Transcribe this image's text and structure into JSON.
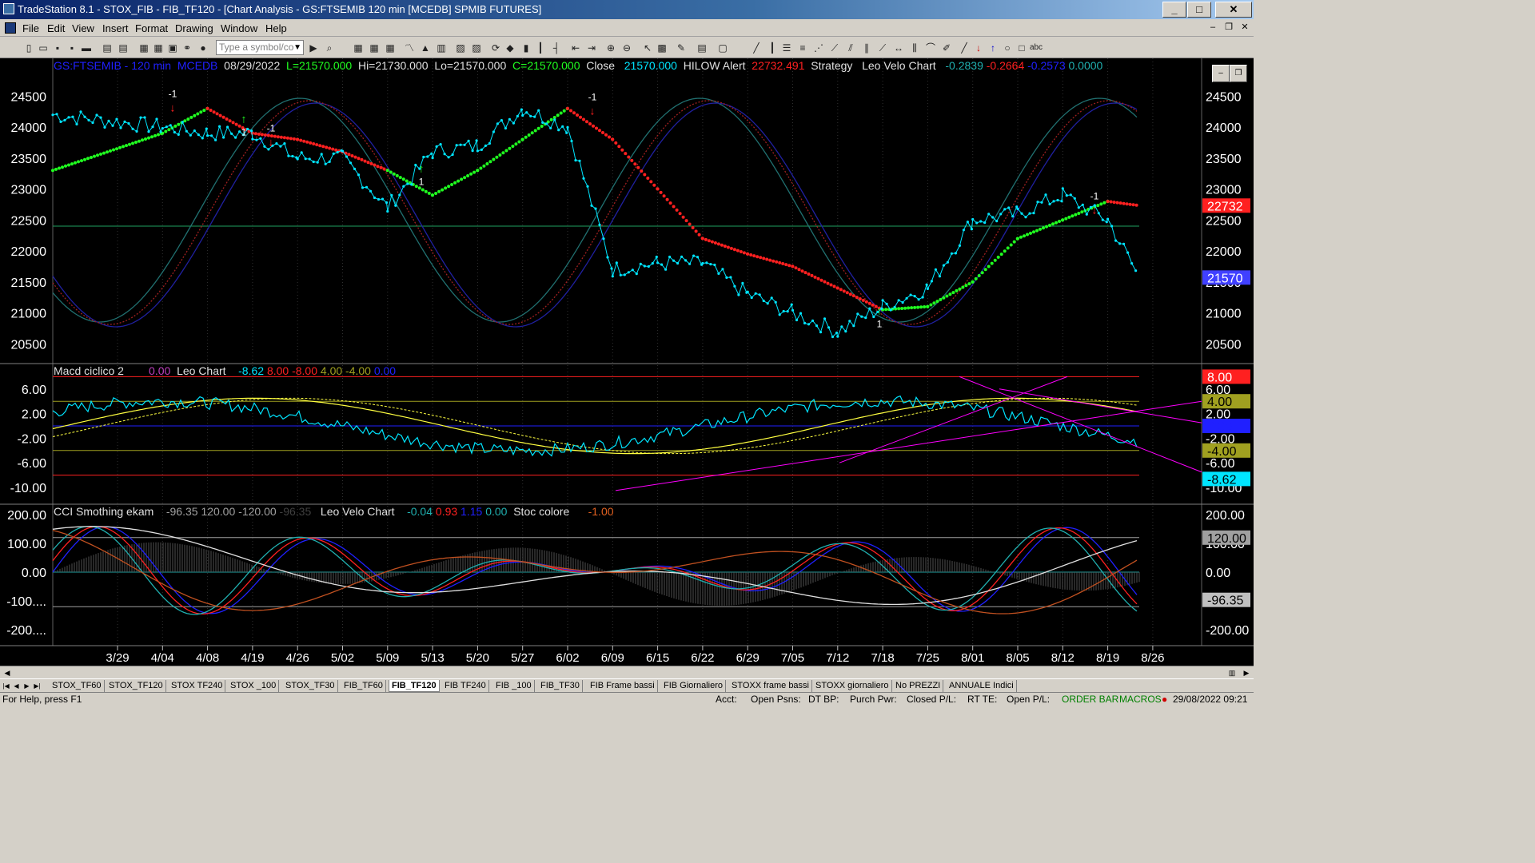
{
  "window": {
    "title": "TradeStation 8.1 - STOX_FIB - FIB_TF120 - [Chart Analysis - GS:FTSEMIB  120 min  [MCEDB] SPMIB FUTURES]",
    "minimize": "_",
    "maximize": "□",
    "close": "✕"
  },
  "menu": {
    "items": [
      "File",
      "Edit",
      "View",
      "Insert",
      "Format",
      "Drawing",
      "Window",
      "Help"
    ],
    "mdi_min": "–",
    "mdi_restore": "❐",
    "mdi_close": "✕"
  },
  "toolbar": {
    "symbol_placeholder": "Type a symbol/co",
    "text_tool": "abc"
  },
  "header": {
    "symbol": "GS:FTSEMIB - 120 min",
    "source": "MCEDB",
    "date": "08/29/2022",
    "low_label": "L=21570.000",
    "high_label": "Hi=21730.000",
    "lo_label": "Lo=21570.000",
    "close_c": "C=21570.000",
    "close_word": "Close",
    "close_val": "21570.000",
    "ind1": "HILOW Alert",
    "ind1_val": "22732.491",
    "ind2": "Strategy",
    "ind3": "Leo Velo Chart",
    "v1": "-0.2839",
    "v2": "-0.2664",
    "v3": "-0.2573",
    "v4": "0.0000"
  },
  "macd_header": {
    "name": "Macd ciclico 2",
    "v0": "0.00",
    "leo": "Leo Chart",
    "a": "-8.62",
    "b": "8.00",
    "c": "-8.00",
    "d": "4.00",
    "e": "-4.00",
    "f": "0.00"
  },
  "cci_header": {
    "name": "CCI Smothing ekam",
    "a": "-96.35",
    "b": "120.00",
    "c": "-120.00",
    "d": "-96.35",
    "leo": "Leo Velo Chart",
    "e": "-0.04",
    "f": "0.93",
    "g": "1.15",
    "h": "0.00",
    "stoc": "Stoc colore",
    "i": "-1.00"
  },
  "axes": {
    "price_ticks": [
      "24500",
      "24000",
      "23500",
      "23000",
      "22500",
      "22000",
      "21500",
      "21000",
      "20500"
    ],
    "macd_ticks": [
      "6.00",
      "2.00",
      "-2.00",
      "-6.00",
      "-10.00"
    ],
    "cci_ticks": [
      "200.00",
      "100.00",
      "0.00",
      "-100....",
      "-200...."
    ],
    "cci_ticks_right": [
      "200.00",
      "100.00",
      "0.00",
      "-100.00",
      "-200.00"
    ],
    "dates": [
      "3/29",
      "4/04",
      "4/08",
      "4/19",
      "4/26",
      "5/02",
      "5/09",
      "5/13",
      "5/20",
      "5/27",
      "6/02",
      "6/09",
      "6/15",
      "6/22",
      "6/29",
      "7/05",
      "7/12",
      "7/18",
      "7/25",
      "8/01",
      "8/05",
      "8/12",
      "8/19",
      "8/26"
    ]
  },
  "price_tags": {
    "hilow": "22732",
    "last": "21570"
  },
  "macd_tags": {
    "p8": "8.00",
    "p4": "4.00",
    "z": "0.00",
    "m4": "-4.00",
    "last": "-8.62"
  },
  "cci_tags": {
    "p120": "120.00",
    "last": "-96.35"
  },
  "signals": {
    "sell": "-1",
    "buy": "1"
  },
  "tabs": [
    "STOX_TF60",
    "STOX_TF120",
    "STOX TF240",
    "STOX _100",
    "STOX_TF30",
    "FIB_TF60",
    "FIB_TF120",
    "FIB TF240",
    "FIB _100",
    "FIB_TF30",
    "FIB Frame bassi",
    "FIB Giornaliero",
    "STOXX frame bassi",
    "STOXX giornaliero",
    "No PREZZI",
    "ANNUALE Indici"
  ],
  "active_tab": "FIB_TF120",
  "status": {
    "help": "For Help, press F1",
    "acct": "Acct:",
    "open_psns": "Open Psns:",
    "dt_bp": "DT BP:",
    "purch_pwr": "Purch Pwr:",
    "closed_pl": "Closed P/L:",
    "rt_te": "RT TE:",
    "open_pl": "Open P/L:",
    "order_bar": "ORDER BAR",
    "macros": "MACROS",
    "datetime": "29/08/2022 09:21"
  },
  "colors": {
    "bg": "#000000",
    "price": "#00e5ff",
    "hilow_red": "#ff2020",
    "hilow_green": "#20ff20",
    "navy": "#2020ff",
    "magenta": "#ff00ff",
    "yellow": "#ffff40"
  },
  "chart_data": {
    "type": "line",
    "x": [
      "3/29",
      "4/04",
      "4/08",
      "4/19",
      "4/26",
      "5/02",
      "5/09",
      "5/13",
      "5/20",
      "5/27",
      "6/02",
      "6/09",
      "6/15",
      "6/22",
      "6/29",
      "7/05",
      "7/12",
      "7/18",
      "7/25",
      "8/01",
      "8/05",
      "8/12",
      "8/19",
      "8/26"
    ],
    "series": [
      {
        "name": "GS:FTSEMIB - 120 min",
        "values": [
          24200,
          24000,
          23900,
          23900,
          23500,
          23500,
          22700,
          23600,
          23700,
          24300,
          24000,
          21700,
          21800,
          21800,
          21300,
          21000,
          20700,
          21100,
          21400,
          22500,
          22600,
          22900,
          22500,
          21570
        ]
      },
      {
        "name": "HILOW Alert",
        "values": [
          23300,
          23900,
          24300,
          23900,
          23800,
          23600,
          23300,
          22900,
          23300,
          23800,
          24300,
          23800,
          23000,
          22200,
          21950,
          21750,
          21400,
          21050,
          21100,
          21500,
          22200,
          22500,
          22800,
          22732
        ]
      }
    ],
    "ylim": [
      20200,
      24900
    ]
  }
}
